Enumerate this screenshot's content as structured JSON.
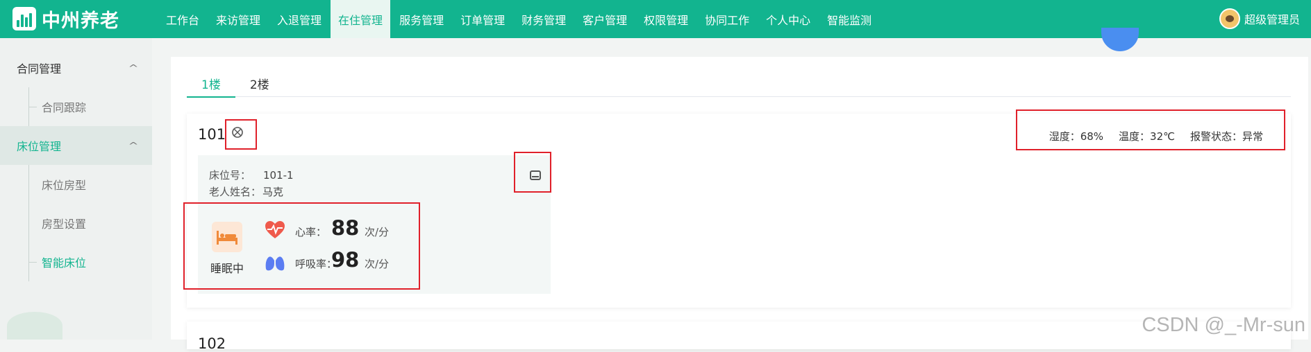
{
  "app": {
    "logo_text": "中州养老"
  },
  "nav": {
    "items": [
      {
        "label": "工作台"
      },
      {
        "label": "来访管理"
      },
      {
        "label": "入退管理"
      },
      {
        "label": "在住管理"
      },
      {
        "label": "服务管理"
      },
      {
        "label": "订单管理"
      },
      {
        "label": "财务管理"
      },
      {
        "label": "客户管理"
      },
      {
        "label": "权限管理"
      },
      {
        "label": "协同工作"
      },
      {
        "label": "个人中心"
      },
      {
        "label": "智能监测"
      }
    ],
    "active": "在住管理"
  },
  "user": {
    "name": "超级管理员"
  },
  "sidebar": {
    "groups": [
      {
        "label": "合同管理",
        "items": [
          {
            "label": "合同跟踪"
          }
        ]
      },
      {
        "label": "床位管理",
        "items": [
          {
            "label": "床位房型"
          },
          {
            "label": "房型设置"
          },
          {
            "label": "智能床位"
          }
        ]
      }
    ],
    "active_item": "智能床位"
  },
  "tabs": [
    {
      "label": "1楼"
    },
    {
      "label": "2楼"
    }
  ],
  "active_tab": "1楼",
  "room": {
    "number": "101",
    "humidity": "湿度：68%",
    "temperature": "温度：32℃",
    "alarm": "报警状态：异常",
    "bed": {
      "bed_no_label": "床位号：",
      "bed_no": "101-1",
      "elder_label": "老人姓名：",
      "elder_name": "马克",
      "status": "睡眠中",
      "heart_label": "心率：",
      "heart_value": "88",
      "heart_unit": "次/分",
      "breath_label": "呼吸率：",
      "breath_value": "98",
      "breath_unit": "次/分"
    }
  },
  "room2": {
    "number": "102"
  },
  "watermark": "CSDN @_-Mr-sun",
  "colors": {
    "primary": "#12b48f",
    "highlight": "#e0202a"
  },
  "icons": {
    "logo": "logo-icon",
    "room_device": "device-icon",
    "bed_device": "bed-device-icon",
    "sleep": "bed-icon",
    "heart": "heart-rate-icon",
    "breath": "lungs-icon"
  }
}
